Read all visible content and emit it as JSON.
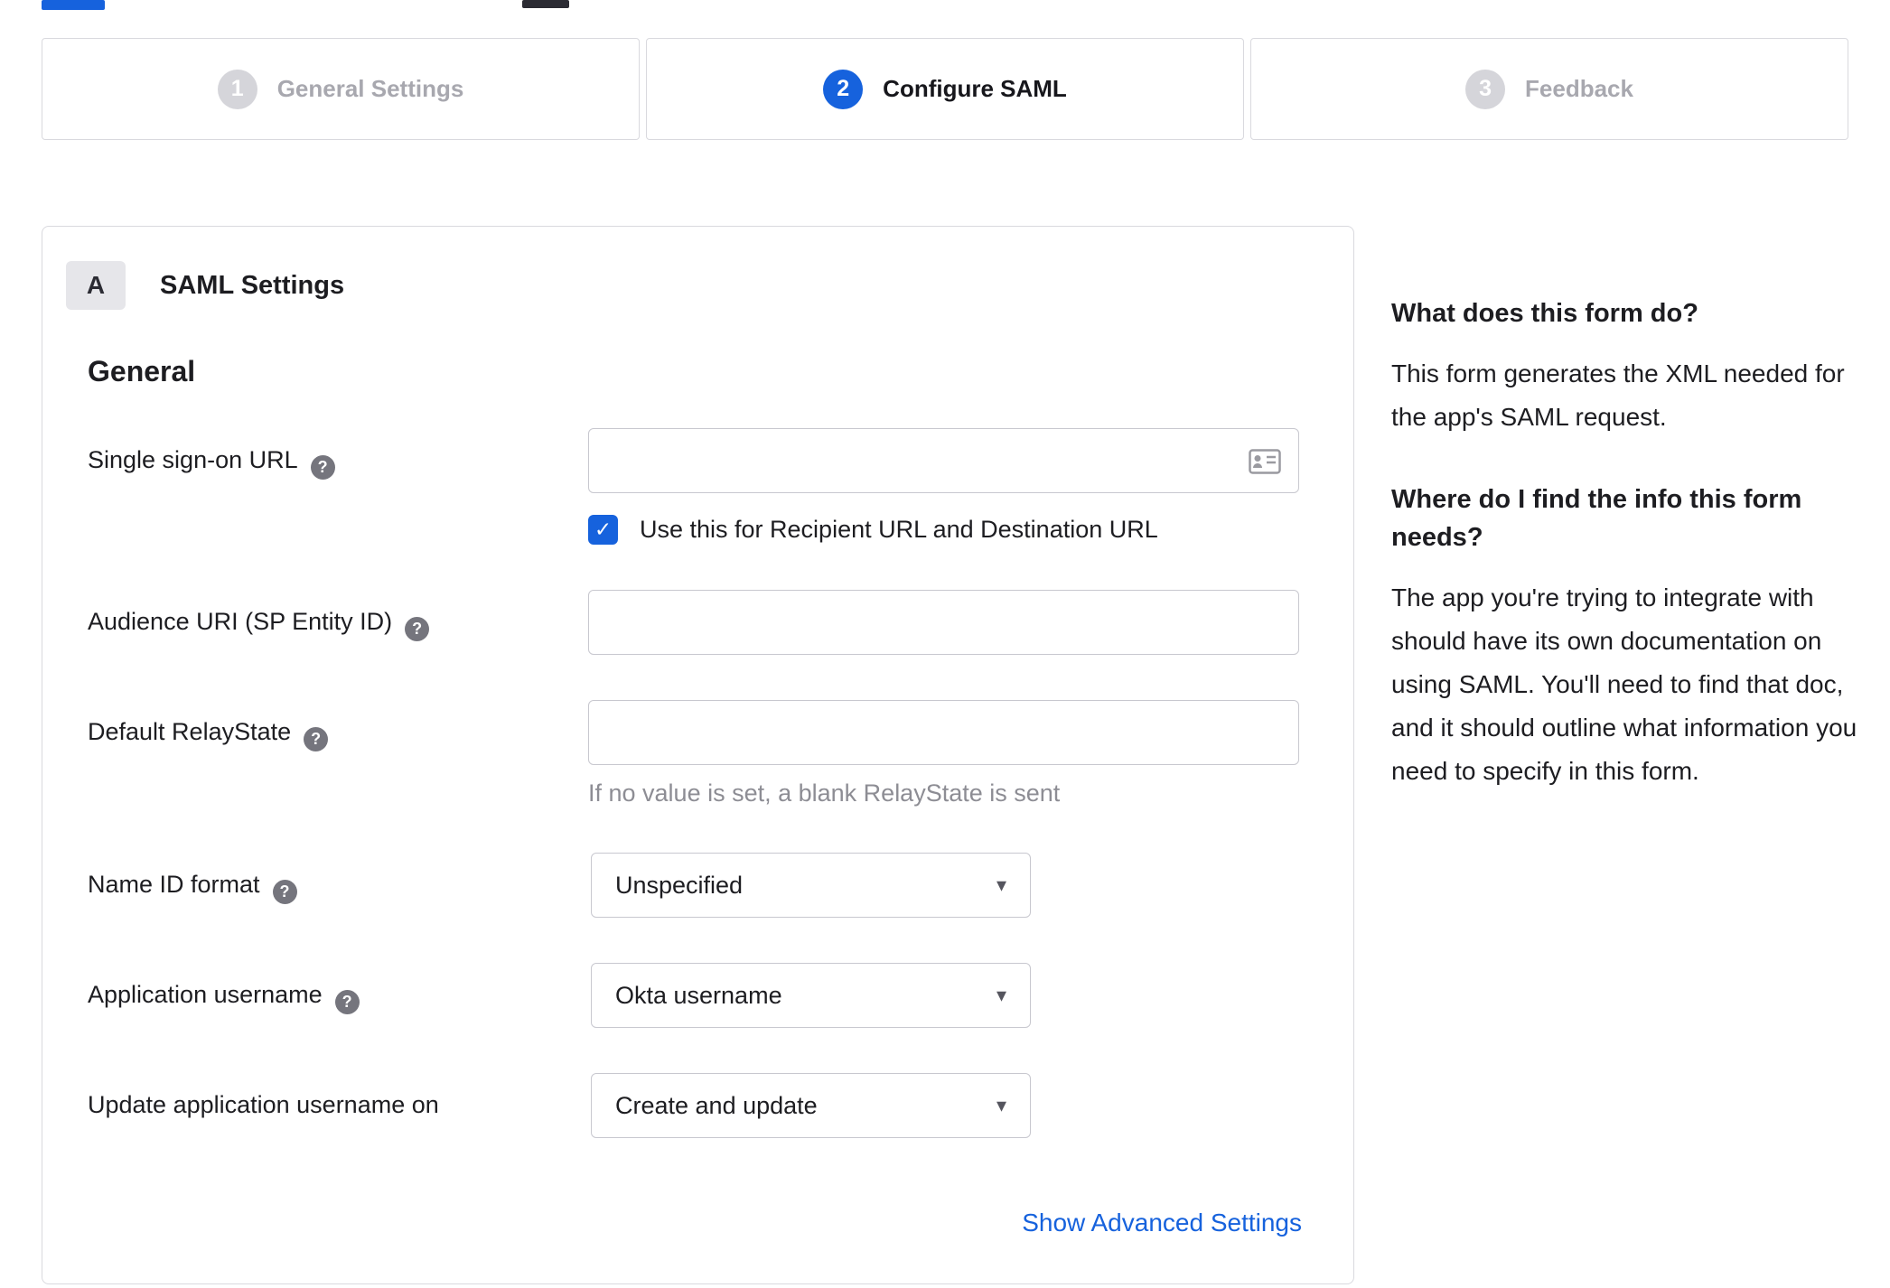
{
  "colors": {
    "accent": "#1662dd",
    "link": "#1662dd",
    "inactive_gray": "#d5d5da"
  },
  "icons": {
    "help": "?",
    "check": "✓",
    "caret": "▾",
    "contact_card": "vcard-icon"
  },
  "stepper": {
    "steps": [
      {
        "number": "1",
        "label": "General Settings",
        "state": "inactive"
      },
      {
        "number": "2",
        "label": "Configure SAML",
        "state": "active"
      },
      {
        "number": "3",
        "label": "Feedback",
        "state": "inactive"
      }
    ]
  },
  "panel": {
    "badge": "A",
    "title": "SAML Settings",
    "section": "General",
    "fields": {
      "sso": {
        "label": "Single sign-on URL",
        "value": "",
        "checkbox_label": "Use this for Recipient URL and Destination URL",
        "checked": true
      },
      "audience": {
        "label": "Audience URI (SP Entity ID)",
        "value": ""
      },
      "relay": {
        "label": "Default RelayState",
        "value": "",
        "hint": "If no value is set, a blank RelayState is sent"
      },
      "nameid": {
        "label": "Name ID format",
        "value": "Unspecified"
      },
      "appusername": {
        "label": "Application username",
        "value": "Okta username"
      },
      "update": {
        "label": "Update application username on",
        "value": "Create and update"
      }
    },
    "advanced_link": "Show Advanced Settings"
  },
  "sidebar": {
    "q1": "What does this form do?",
    "a1": "This form generates the XML needed for the app's SAML request.",
    "q2": "Where do I find the info this form needs?",
    "a2": "The app you're trying to integrate with should have its own documentation on using SAML. You'll need to find that doc, and it should outline what information you need to specify in this form."
  }
}
